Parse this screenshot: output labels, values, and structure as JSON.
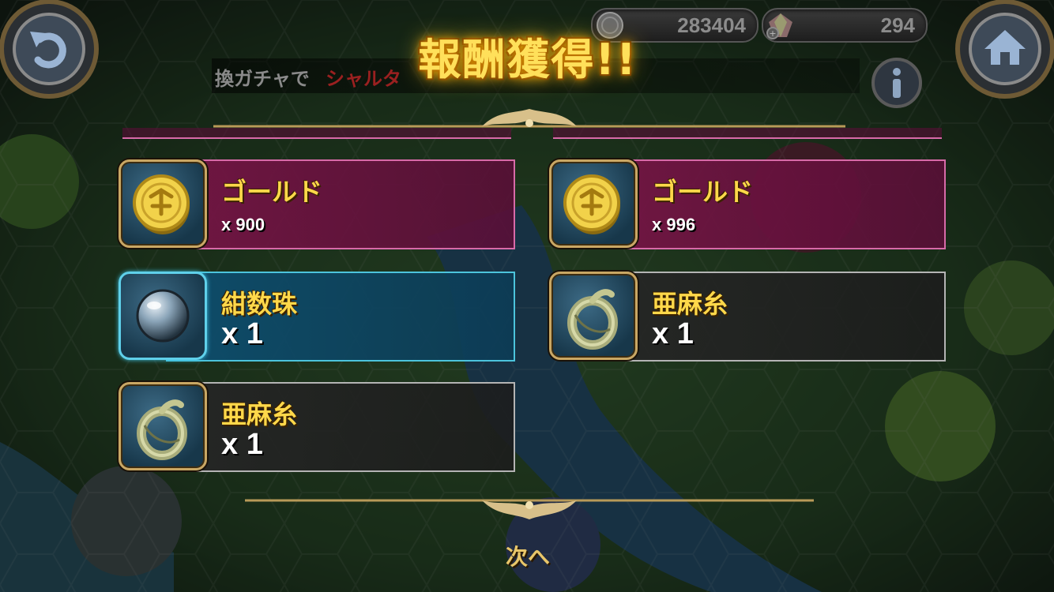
{
  "header": {
    "title": "報酬獲得!!",
    "currency_gold": "283404",
    "currency_gems": "294",
    "ticker_prefix": "換ガチャで",
    "ticker_highlight": "シャルタ",
    "icons": {
      "back": "back-arrow-icon",
      "home": "home-icon",
      "info": "info-icon",
      "gold": "gold-coin-icon",
      "gems": "rainbow-gem-icon"
    }
  },
  "rewards": [
    {
      "name": "ゴールド",
      "quantity": "x 900",
      "rarity": "gold",
      "icon": "gold-coin-icon"
    },
    {
      "name": "ゴールド",
      "quantity": "x 996",
      "rarity": "gold",
      "icon": "gold-coin-icon"
    },
    {
      "name": "紺数珠",
      "quantity": "x 1",
      "rarity": "blue",
      "icon": "pearl-orb-icon"
    },
    {
      "name": "亜麻糸",
      "quantity": "x 1",
      "rarity": "gray",
      "icon": "flax-thread-icon"
    },
    {
      "name": "亜麻糸",
      "quantity": "x 1",
      "rarity": "gray",
      "icon": "flax-thread-icon"
    }
  ],
  "footer": {
    "next_label": "次へ"
  },
  "colors": {
    "title_gold": "#ffe05a",
    "gold_border": "#d86aa8",
    "blue_border": "#4cc4dc",
    "gray_border": "#b4b4b4",
    "item_name": "#ffd84a"
  }
}
